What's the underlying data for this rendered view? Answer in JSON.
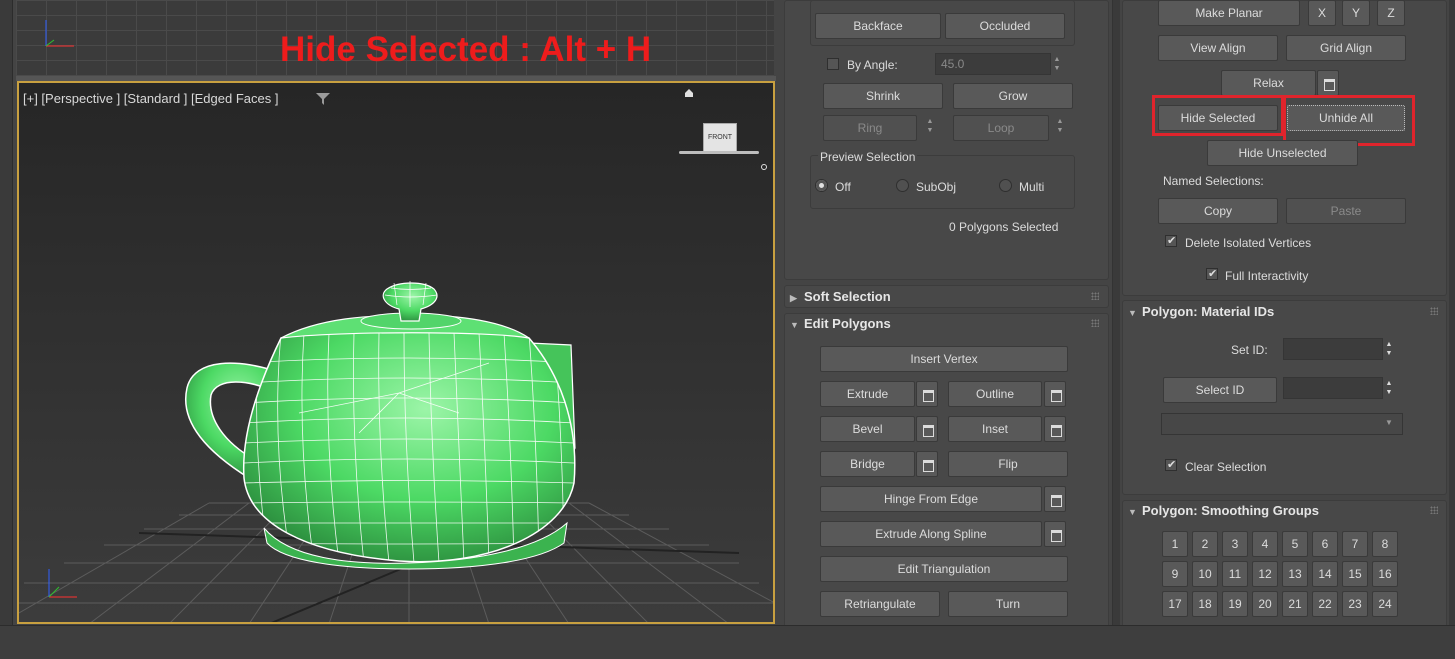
{
  "overlay_title": "Hide Selected : Alt + H",
  "viewport": {
    "label": "[+] [Perspective ] [Standard ] [Edged Faces ]",
    "viewcube_label": "FRONT"
  },
  "selection_panel": {
    "backface": "Backface",
    "occluded": "Occluded",
    "by_angle": "By Angle:",
    "angle_value": "45.0",
    "shrink": "Shrink",
    "grow": "Grow",
    "ring": "Ring",
    "loop": "Loop",
    "preview_group": "Preview Selection",
    "preview_options": [
      "Off",
      "SubObj",
      "Multi"
    ],
    "status": "0 Polygons Selected"
  },
  "soft_selection": {
    "title": "Soft Selection"
  },
  "edit_polygons": {
    "title": "Edit Polygons",
    "insert_vertex": "Insert Vertex",
    "extrude": "Extrude",
    "outline": "Outline",
    "bevel": "Bevel",
    "inset": "Inset",
    "bridge": "Bridge",
    "flip": "Flip",
    "hinge_from_edge": "Hinge From Edge",
    "extrude_along_spline": "Extrude Along Spline",
    "edit_triangulation": "Edit Triangulation",
    "retriangulate": "Retriangulate",
    "turn": "Turn"
  },
  "edit_geometry": {
    "make_planar": "Make Planar",
    "x": "X",
    "y": "Y",
    "z": "Z",
    "view_align": "View Align",
    "grid_align": "Grid Align",
    "relax": "Relax",
    "hide_selected": "Hide Selected",
    "unhide_all": "Unhide All",
    "hide_unselected": "Hide Unselected",
    "named_selections": "Named Selections:",
    "copy": "Copy",
    "paste": "Paste",
    "delete_isolated": "Delete Isolated Vertices",
    "full_interactivity": "Full Interactivity"
  },
  "material_ids": {
    "title": "Polygon: Material IDs",
    "set_id": "Set ID:",
    "select_id": "Select ID",
    "clear_selection": "Clear Selection"
  },
  "smoothing_groups": {
    "title": "Polygon: Smoothing Groups",
    "groups": [
      "1",
      "2",
      "3",
      "4",
      "5",
      "6",
      "7",
      "8",
      "9",
      "10",
      "11",
      "12",
      "13",
      "14",
      "15",
      "16",
      "17",
      "18",
      "19",
      "20",
      "21",
      "22",
      "23",
      "24"
    ]
  },
  "colors": {
    "highlight": "#e0242c",
    "teapot": "#4cd964",
    "viewport_border": "#c8a040"
  }
}
